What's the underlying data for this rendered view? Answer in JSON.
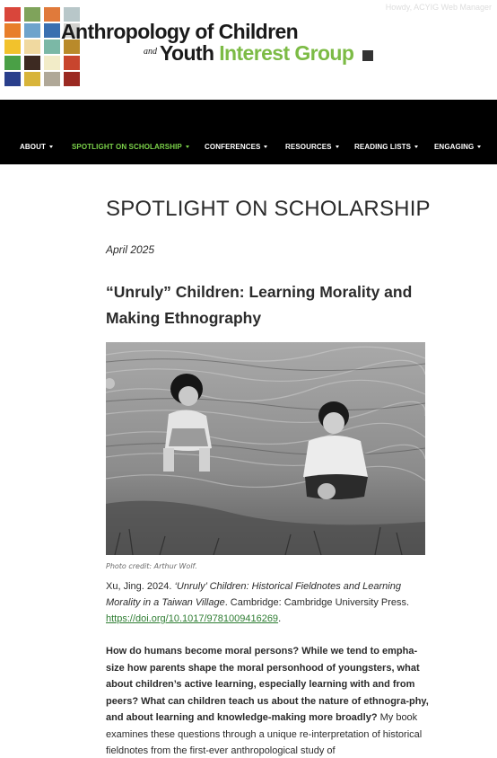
{
  "header": {
    "logo": {
      "line1": "Anthropology of Children",
      "and_word_top": "and",
      "line2_dark": "Youth",
      "line2_green": " Interest Group",
      "green_color": "#7cbb45",
      "tile_colors": [
        "#d9463b",
        "#7fa35b",
        "#e07a3b",
        "#b8c7c9",
        "#e87e2a",
        "#6ea3cc",
        "#3a6fb0",
        "#d2d2cf",
        "#f2c22c",
        "#f0d9a0",
        "#7bb8a6",
        "#b98a2a",
        "#4aa046",
        "#3d2a22",
        "#f2ecc8",
        "#c8452e",
        "#2a3f8c",
        "#d8b43a",
        "#b0a898",
        "#9b2a22"
      ]
    },
    "howdy": "Howdy, ACYIG Web Manager"
  },
  "nav": {
    "items": [
      {
        "label": "ABOUT"
      },
      {
        "label": "SPOTLIGHT ON SCHOLARSHIP"
      },
      {
        "label": "CONFERENCES"
      },
      {
        "label": "RESOURCES"
      },
      {
        "label": "READING LISTS"
      },
      {
        "label": "ENGAGING"
      }
    ],
    "active_color": "#7cd34a"
  },
  "page": {
    "title": "SPOTLIGHT ON SCHOLARSHIP",
    "date": "April 2025",
    "post_title": "“Unruly” Children: Learning Morality and Making Ethnography",
    "photo_credit": "Photo credit: Arthur Wolf.",
    "citation": {
      "prefix": "Xu, Jing. 2024. ",
      "book_title": "‘Unruly’ Children: Historical Fieldnotes and Learning Morality in a Taiwan Village",
      "suffix": ". Cambridge: Cambridge University Press. ",
      "doi": "https://doi.org/10.1017/9781009416269",
      "end": ".",
      "link_color": "#2e7d32"
    },
    "abstract": {
      "bold": "How do humans become moral persons? While we tend to empha-size how parents shape the moral personhood of youngsters, what about children’s active learning, especially learning with and from peers? What can children teach us about the nature of ethnogra-phy, and about learning and knowledge-making more broadly?",
      "normal": " My book examines these questions through a unique re-interpretation of historical fieldnotes from the first-ever anthropological study of"
    }
  }
}
